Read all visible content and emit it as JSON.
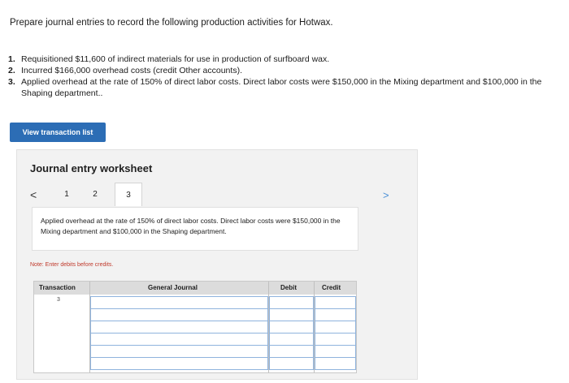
{
  "problem": {
    "prompt": "Prepare journal entries to record the following production activities for Hotwax.",
    "steps": [
      {
        "num": "1.",
        "text": "Requisitioned $11,600 of indirect materials for use in production of surfboard wax."
      },
      {
        "num": "2.",
        "text": "Incurred $166,000 overhead costs (credit Other accounts)."
      },
      {
        "num": "3.",
        "text": "Applied overhead at the rate of 150% of direct labor costs. Direct labor costs were $150,000 in the Mixing department and $100,000 in the Shaping department.."
      }
    ]
  },
  "view_button_label": "View transaction list",
  "worksheet": {
    "title": "Journal entry worksheet",
    "prev_glyph": "<",
    "next_glyph": ">",
    "tabs": [
      "1",
      "2",
      "3"
    ],
    "active_tab": "3",
    "description": "Applied overhead at the rate of 150% of direct labor costs. Direct labor costs were $150,000 in the Mixing department and $100,000 in the Shaping department.",
    "note": "Note: Enter debits before credits.",
    "table": {
      "headers": {
        "transaction": "Transaction",
        "general_journal": "General Journal",
        "debit": "Debit",
        "credit": "Credit"
      },
      "transaction_number": "3",
      "row_count": 6
    }
  }
}
